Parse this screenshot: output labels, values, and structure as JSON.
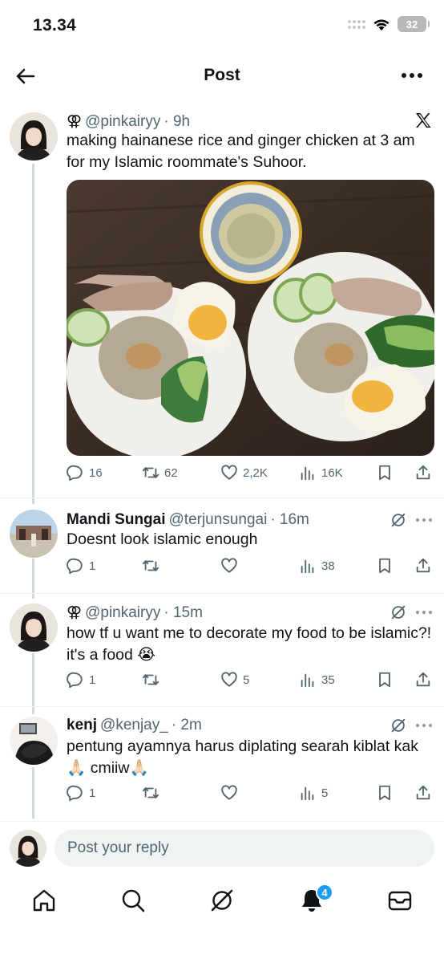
{
  "status_bar": {
    "time": "13.34",
    "battery": "32"
  },
  "nav": {
    "title": "Post",
    "back_icon": "arrow-left-icon",
    "more_icon": "more-horizontal-icon"
  },
  "main_post": {
    "gender_symbol": "⚢",
    "handle": "@pinkairyy",
    "time": "· 9h",
    "text": "making hainanese rice and ginger chicken at 3 am for my Islamic roommate's Suhoor.",
    "stats": {
      "replies": "16",
      "reposts": "62",
      "likes": "2,2K",
      "views": "16K"
    }
  },
  "replies": [
    {
      "name": "Mandi Sungai",
      "handle": "@terjunsungai",
      "time": "· 16m",
      "text": "Doesnt look islamic enough",
      "stats": {
        "replies": "1",
        "reposts": "",
        "likes": "",
        "views": "38"
      }
    },
    {
      "gender_symbol": "⚢",
      "handle": "@pinkairyy",
      "time": "· 15m",
      "text": "how tf u want me to decorate my food to be islamic?! it's a food 😭",
      "stats": {
        "replies": "1",
        "reposts": "",
        "likes": "5",
        "views": "35"
      }
    },
    {
      "name": "kenj",
      "handle": "@kenjay_",
      "time": "· 2m",
      "text": "pentung ayamnya harus diplating searah kiblat kak🙏🏻 cmiiw🙏🏻",
      "stats": {
        "replies": "1",
        "reposts": "",
        "likes": "",
        "views": "5"
      }
    }
  ],
  "composer": {
    "placeholder": "Post your reply"
  },
  "tabbar": {
    "items": [
      "home-icon",
      "search-icon",
      "grok-icon",
      "notifications-icon",
      "messages-icon"
    ],
    "notification_badge": "4"
  },
  "colors": {
    "accent": "#1d9bf0",
    "text": "#0f1419",
    "muted": "#536471",
    "line": "#cfd9de"
  }
}
